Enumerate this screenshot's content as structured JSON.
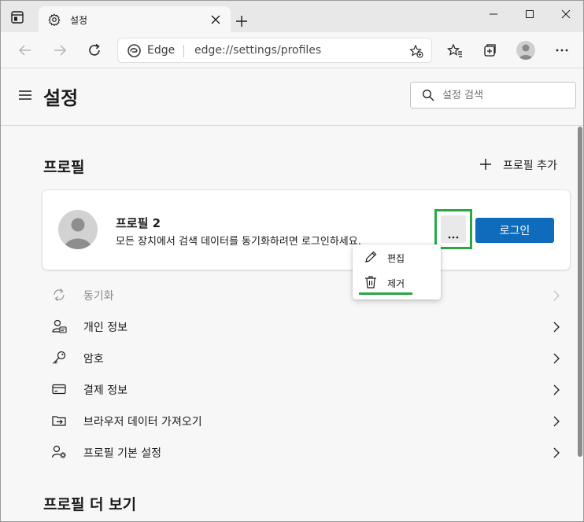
{
  "tab": {
    "title": "설정"
  },
  "address": {
    "brand": "Edge",
    "url": "edge://settings/profiles"
  },
  "header": {
    "title": "설정",
    "search_placeholder": "설정 검색"
  },
  "profiles_section": {
    "title": "프로필",
    "add_label": "프로필 추가"
  },
  "profile_card": {
    "name": "프로필 2",
    "description": "모든 장치에서 검색 데이터를 동기화하려면 로그인하세요.",
    "login_label": "로그인"
  },
  "context_menu": {
    "items": [
      {
        "label": "편집",
        "icon": "pencil-icon"
      },
      {
        "label": "제거",
        "icon": "trash-icon"
      }
    ]
  },
  "settings_list": [
    {
      "label": "동기화",
      "icon": "sync-icon",
      "enabled": false
    },
    {
      "label": "개인 정보",
      "icon": "personal-info-icon",
      "enabled": true
    },
    {
      "label": "암호",
      "icon": "key-icon",
      "enabled": true
    },
    {
      "label": "결제 정보",
      "icon": "card-icon",
      "enabled": true
    },
    {
      "label": "브라우저 데이터 가져오기",
      "icon": "import-icon",
      "enabled": true
    },
    {
      "label": "프로필 기본 설정",
      "icon": "profile-settings-icon",
      "enabled": true
    }
  ],
  "more_profiles_section": {
    "title": "프로필 더 보기"
  },
  "colors": {
    "accent": "#0f6cbd",
    "highlight": "#2aa645",
    "page_bg": "#f7f7f7"
  }
}
